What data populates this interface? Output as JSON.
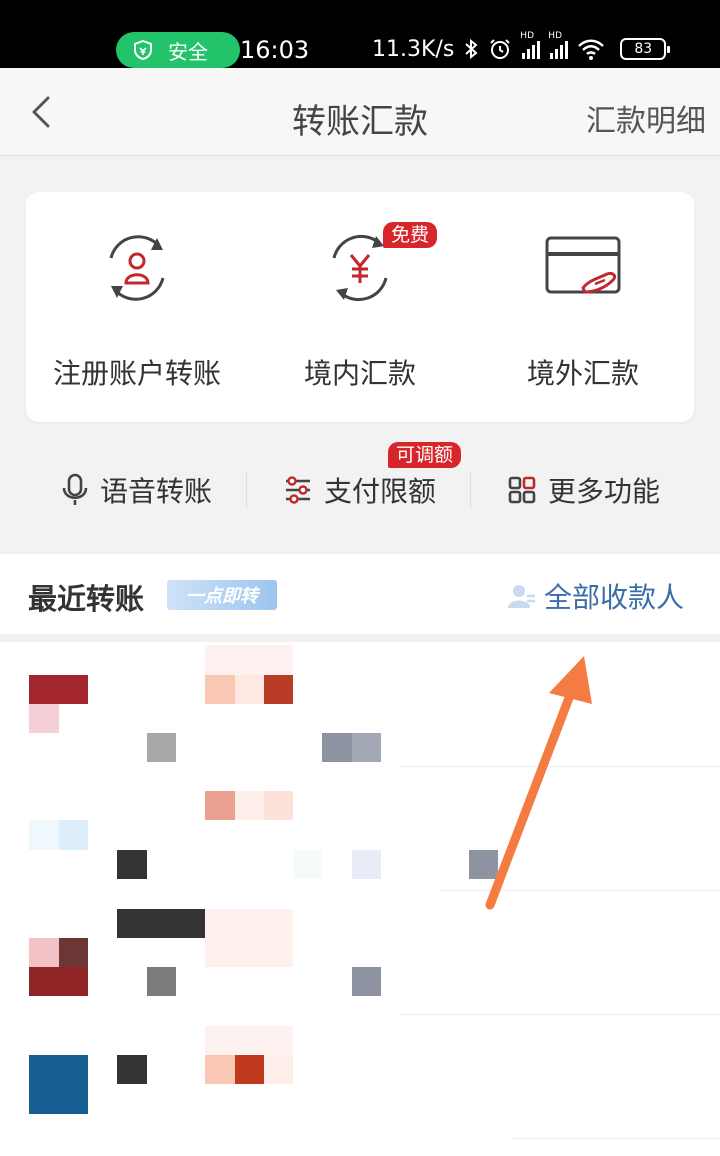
{
  "status_bar": {
    "safe_label": "安全",
    "time": "16:03",
    "net_speed": "11.3K/s",
    "signal_tag": "HD",
    "battery": "83"
  },
  "header": {
    "title": "转账汇款",
    "detail_link": "汇款明细"
  },
  "main_services": [
    {
      "label": "注册账户转账",
      "icon": "account-transfer-icon"
    },
    {
      "label": "境内汇款",
      "icon": "yuan-transfer-icon",
      "badge": "免费"
    },
    {
      "label": "境外汇款",
      "icon": "card-hand-icon"
    }
  ],
  "quick_actions": [
    {
      "label": "语音转账",
      "icon": "microphone-icon"
    },
    {
      "label": "支付限额",
      "icon": "sliders-icon",
      "badge": "可调额"
    },
    {
      "label": "更多功能",
      "icon": "grid-icon"
    }
  ],
  "recent": {
    "title": "最近转账",
    "tag": "一点即转",
    "all_payees": "全部收款人"
  },
  "colors": {
    "accent_red": "#d7262b",
    "link_blue": "#3b6ea8",
    "annotation_arrow": "#f47c42",
    "safe_green": "#22c36b"
  }
}
